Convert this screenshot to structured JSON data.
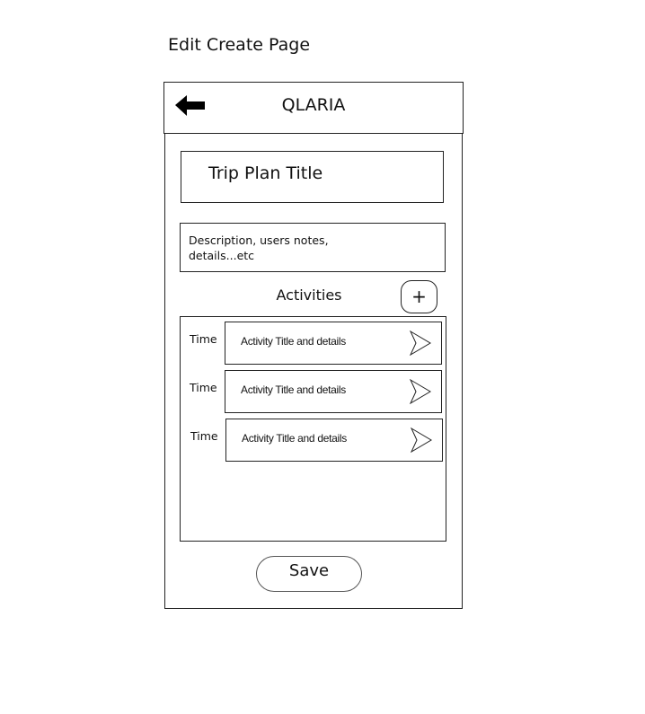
{
  "page_title": "Edit Create Page",
  "header": {
    "app_title": "QLARIA",
    "back_icon": "arrow-left-icon"
  },
  "form": {
    "trip_title": "Trip Plan Title",
    "description_line1": "Description, users notes,",
    "description_line2": "details...etc"
  },
  "activities": {
    "label": "Activities",
    "add_label": "+",
    "items": [
      {
        "time": "Time",
        "title": "Activity Title and details"
      },
      {
        "time": "Time",
        "title": "Activity Title and details"
      },
      {
        "time": "Time",
        "title": "Activity Title and details"
      }
    ]
  },
  "save_label": "Save"
}
